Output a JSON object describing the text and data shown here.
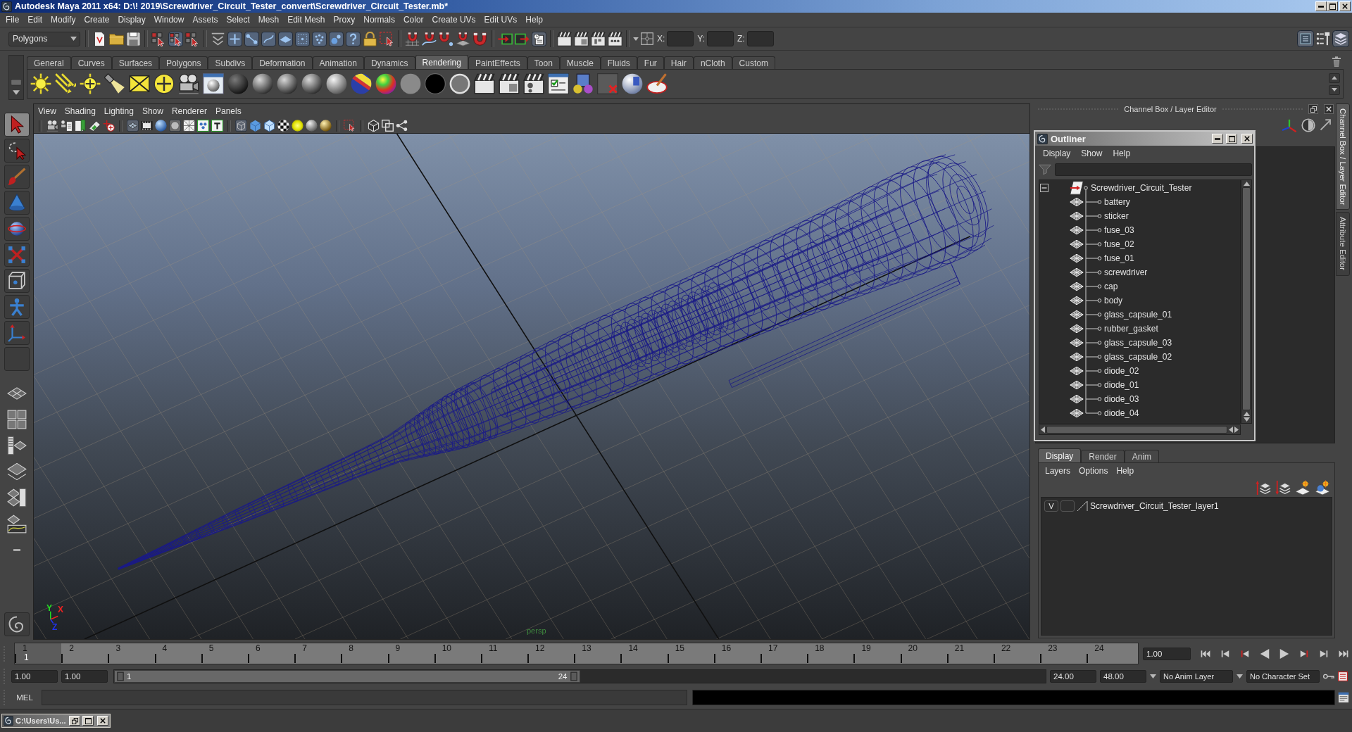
{
  "window": {
    "title": "Autodesk Maya 2011 x64: D:\\! 2019\\Screwdriver_Circuit_Tester_convert\\Screwdriver_Circuit_Tester.mb*"
  },
  "menu_bar": [
    "File",
    "Edit",
    "Modify",
    "Create",
    "Display",
    "Window",
    "Assets",
    "Select",
    "Mesh",
    "Edit Mesh",
    "Proxy",
    "Normals",
    "Color",
    "Create UVs",
    "Edit UVs",
    "Help"
  ],
  "status_line": {
    "menu_set": "Polygons",
    "coordinate_fields": [
      {
        "label": "X:"
      },
      {
        "label": "Y:"
      },
      {
        "label": "Z:"
      }
    ]
  },
  "shelf": {
    "tabs": [
      {
        "label": "General",
        "selected": false
      },
      {
        "label": "Curves",
        "selected": false
      },
      {
        "label": "Surfaces",
        "selected": false
      },
      {
        "label": "Polygons",
        "selected": false
      },
      {
        "label": "Subdivs",
        "selected": false
      },
      {
        "label": "Deformation",
        "selected": false
      },
      {
        "label": "Animation",
        "selected": false
      },
      {
        "label": "Dynamics",
        "selected": false
      },
      {
        "label": "Rendering",
        "selected": true
      },
      {
        "label": "PaintEffects",
        "selected": false
      },
      {
        "label": "Toon",
        "selected": false
      },
      {
        "label": "Muscle",
        "selected": false
      },
      {
        "label": "Fluids",
        "selected": false
      },
      {
        "label": "Fur",
        "selected": false
      },
      {
        "label": "Hair",
        "selected": false
      },
      {
        "label": "nCloth",
        "selected": false
      },
      {
        "label": "Custom",
        "selected": false
      }
    ]
  },
  "toolbox": {
    "tools": [
      {
        "selected": true
      },
      {
        "selected": false
      },
      {
        "selected": false
      },
      {
        "selected": false
      },
      {
        "selected": false
      },
      {
        "selected": false
      },
      {
        "selected": false
      },
      {
        "selected": false
      },
      {
        "selected": false
      },
      {
        "selected": false
      }
    ]
  },
  "viewport": {
    "menu": [
      "View",
      "Shading",
      "Lighting",
      "Show",
      "Renderer",
      "Panels"
    ],
    "camera_label": "persp",
    "axis_labels": [
      {
        "text": "Y",
        "color": "#22dd22"
      },
      {
        "text": "X",
        "color": "#ee2222"
      },
      {
        "text": "Z",
        "color": "#2233ee"
      }
    ]
  },
  "channel_box": {
    "title": "Channel Box / Layer Editor"
  },
  "outliner": {
    "title": "Outliner",
    "menu": [
      "Display",
      "Show",
      "Help"
    ],
    "tree": [
      {
        "label": "Screwdriver_Circuit_Tester",
        "expanded": true,
        "children": [
          {
            "label": "battery"
          },
          {
            "label": "sticker"
          },
          {
            "label": "fuse_03"
          },
          {
            "label": "fuse_02"
          },
          {
            "label": "fuse_01"
          },
          {
            "label": "screwdriver"
          },
          {
            "label": "cap"
          },
          {
            "label": "body"
          },
          {
            "label": "glass_capsule_01"
          },
          {
            "label": "rubber_gasket"
          },
          {
            "label": "glass_capsule_03"
          },
          {
            "label": "glass_capsule_02"
          },
          {
            "label": "diode_02"
          },
          {
            "label": "diode_01"
          },
          {
            "label": "diode_03"
          },
          {
            "label": "diode_04"
          }
        ]
      }
    ]
  },
  "layer_editor": {
    "tabs": [
      {
        "label": "Display",
        "selected": true
      },
      {
        "label": "Render",
        "selected": false
      },
      {
        "label": "Anim",
        "selected": false
      }
    ],
    "menu": [
      "Layers",
      "Options",
      "Help"
    ],
    "layers": [
      {
        "visibility": "V",
        "name": "Screwdriver_Circuit_Tester_layer1"
      }
    ]
  },
  "side_tabs": [
    {
      "label": "Channel Box / Layer Editor",
      "selected": true
    },
    {
      "label": "Attribute Editor",
      "selected": false
    }
  ],
  "time_slider": {
    "frames": [
      "1",
      "2",
      "3",
      "4",
      "5",
      "6",
      "7",
      "8",
      "9",
      "10",
      "11",
      "12",
      "13",
      "14",
      "15",
      "16",
      "17",
      "18",
      "19",
      "20",
      "21",
      "22",
      "23",
      "24"
    ],
    "current_frame": "1",
    "level": 0.0415,
    "current_time": "1.00"
  },
  "range_slider": {
    "start_time": "1.00",
    "range_start": "1.00",
    "level": 0.5,
    "handle_start": "1",
    "handle_end": "24",
    "range_end": "24.00",
    "end_time": "48.00",
    "anim_layer": "No Anim Layer",
    "character_set": "No Character Set"
  },
  "command_line": {
    "language": "MEL"
  },
  "taskbar": {
    "windows": [
      {
        "title": "C:\\Users\\Us..."
      }
    ]
  }
}
